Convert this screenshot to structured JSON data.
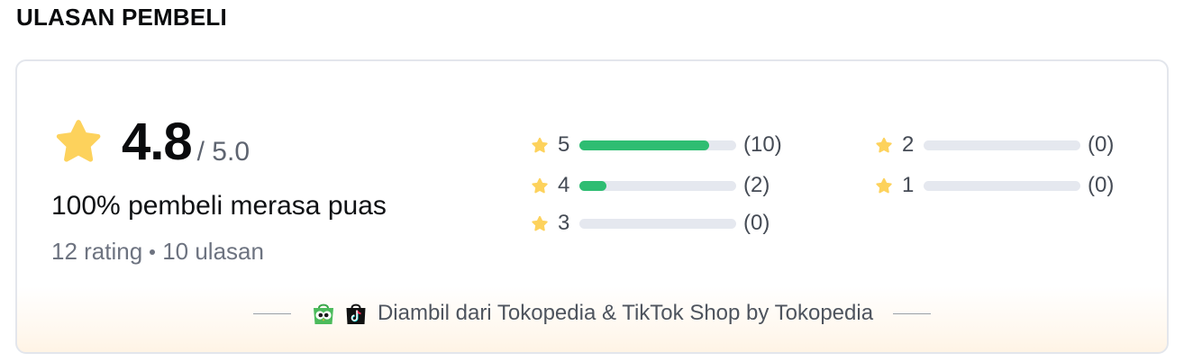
{
  "section": {
    "title": "ULASAN PEMBELI"
  },
  "summary": {
    "score": "4.8",
    "score_max": "/ 5.0",
    "satisfaction": "100% pembeli merasa puas",
    "ratings": "12 rating",
    "reviews": "10 ulasan"
  },
  "distribution": [
    {
      "level": "5",
      "count": "(10)",
      "fraction": 0.83
    },
    {
      "level": "4",
      "count": "(2)",
      "fraction": 0.17
    },
    {
      "level": "3",
      "count": "(0)",
      "fraction": 0
    },
    {
      "level": "2",
      "count": "(0)",
      "fraction": 0
    },
    {
      "level": "1",
      "count": "(0)",
      "fraction": 0
    }
  ],
  "footer": {
    "source_text": "Diambil dari Tokopedia & TikTok Shop by Tokopedia"
  },
  "icons": {
    "star": "star-icon",
    "tokopedia": "tokopedia-logo-icon",
    "tiktok": "tiktok-shop-logo-icon"
  },
  "colors": {
    "star": "#fdd25c",
    "bar_fill": "#2ebd72",
    "bar_track": "#e5e8ef"
  }
}
